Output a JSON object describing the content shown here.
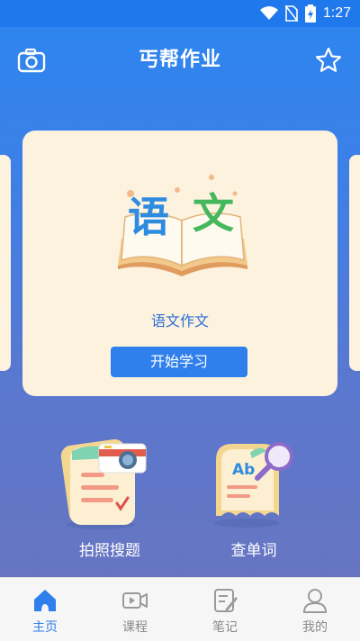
{
  "status": {
    "time": "1:27"
  },
  "header": {
    "title": "丐帮作业",
    "left_icon": "camera-icon",
    "right_icon": "star-icon"
  },
  "card": {
    "illustration_text": [
      "语",
      "文"
    ],
    "label": "语文作文",
    "button": "开始学习"
  },
  "features": [
    {
      "label": "拍照搜题",
      "icon": "photo-search-icon"
    },
    {
      "label": "查单词",
      "icon": "dictionary-icon",
      "illustration_text": "Ab"
    }
  ],
  "nav": [
    {
      "label": "主页",
      "icon": "home-icon",
      "active": true
    },
    {
      "label": "课程",
      "icon": "video-icon"
    },
    {
      "label": "笔记",
      "icon": "note-icon"
    },
    {
      "label": "我的",
      "icon": "user-icon"
    }
  ],
  "colors": {
    "accent": "#2f80ec",
    "card_bg": "#fcf2de",
    "nav_bg": "#f6f6f6"
  }
}
